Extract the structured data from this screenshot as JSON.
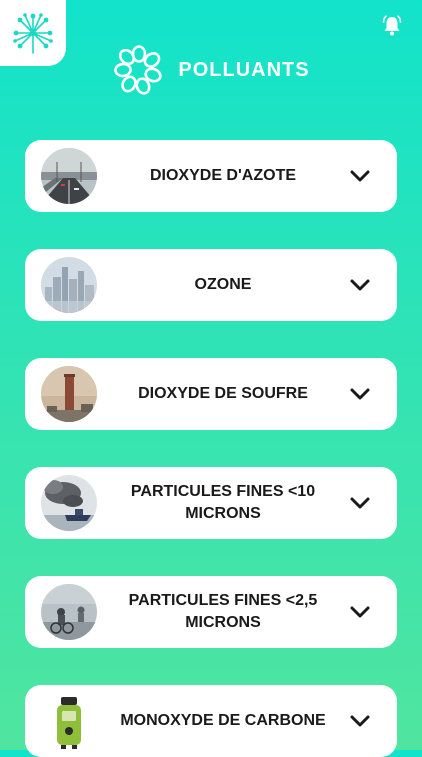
{
  "header": {
    "title": "POLLUANTS"
  },
  "icons": {
    "app_logo": "dandelion-icon",
    "notifications": "bell-alert-icon",
    "header_logo": "flower-icon",
    "expand": "chevron-down-icon"
  },
  "colors": {
    "background_top": "#12e3cb",
    "background_bottom": "#50e59f",
    "accent": "#1ad8c3",
    "card": "#ffffff",
    "text": "#1a1a1a"
  },
  "pollutants": [
    {
      "label": "DIOXYDE D'AZOTE"
    },
    {
      "label": "OZONE"
    },
    {
      "label": "DIOXYDE DE SOUFRE"
    },
    {
      "label": "PARTICULES FINES <10 MICRONS"
    },
    {
      "label": "PARTICULES FINES <2,5 MICRONS"
    },
    {
      "label": "MONOXYDE DE CARBONE"
    }
  ]
}
